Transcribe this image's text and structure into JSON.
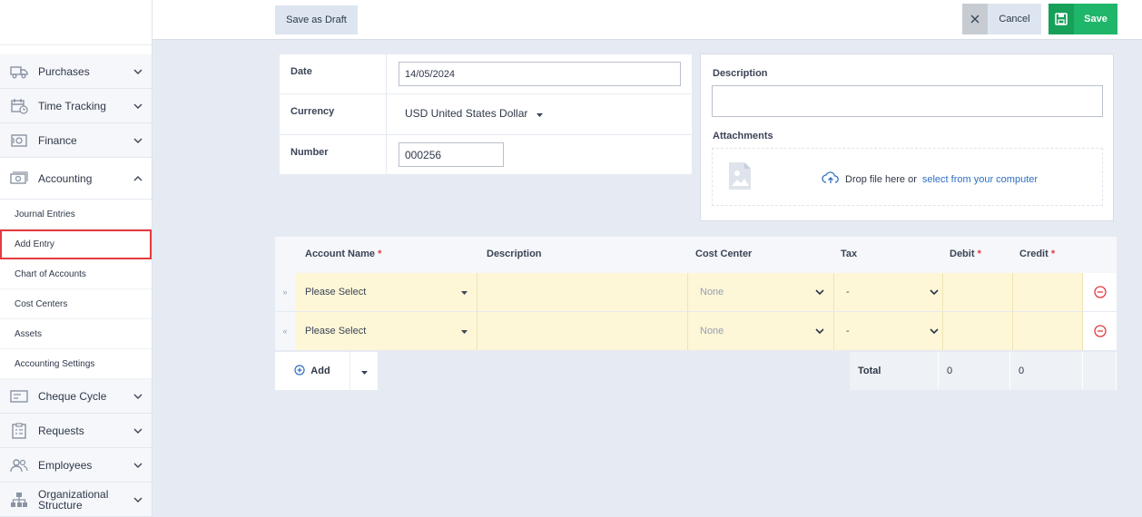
{
  "sidebar": {
    "sections": [
      {
        "label": "Purchases",
        "icon": "truck-icon",
        "expanded": false
      },
      {
        "label": "Time Tracking",
        "icon": "calendar-clock-icon",
        "expanded": false
      },
      {
        "label": "Finance",
        "icon": "safe-icon",
        "expanded": false
      },
      {
        "label": "Accounting",
        "icon": "money-icon",
        "expanded": true
      },
      {
        "label": "Cheque Cycle",
        "icon": "cheque-icon",
        "expanded": false
      },
      {
        "label": "Requests",
        "icon": "clipboard-icon",
        "expanded": false
      },
      {
        "label": "Employees",
        "icon": "users-icon",
        "expanded": false
      },
      {
        "label": "Organizational Structure",
        "icon": "org-chart-icon",
        "expanded": false
      }
    ],
    "accounting_items": [
      {
        "label": "Journal Entries"
      },
      {
        "label": "Add Entry",
        "active": true
      },
      {
        "label": "Chart of Accounts"
      },
      {
        "label": "Cost Centers"
      },
      {
        "label": "Assets"
      },
      {
        "label": "Accounting Settings"
      }
    ]
  },
  "toolbar": {
    "draft_label": "Save as Draft",
    "cancel_label": "Cancel",
    "save_label": "Save"
  },
  "form": {
    "date_label": "Date",
    "date_value": "14/05/2024",
    "currency_label": "Currency",
    "currency_value": "USD United States Dollar",
    "number_label": "Number",
    "number_value": "000256"
  },
  "details": {
    "description_label": "Description",
    "description_value": "",
    "attachments_label": "Attachments",
    "drop_text": "Drop file here or",
    "drop_link": "select from your computer"
  },
  "table": {
    "headers": {
      "account": "Account Name",
      "description": "Description",
      "cost_center": "Cost Center",
      "tax": "Tax",
      "debit": "Debit",
      "credit": "Credit",
      "required_mark": "*"
    },
    "rows": [
      {
        "account": "Please Select",
        "description": "",
        "cost_center": "None",
        "tax": "-",
        "debit": "",
        "credit": ""
      },
      {
        "account": "Please Select",
        "description": "",
        "cost_center": "None",
        "tax": "-",
        "debit": "",
        "credit": ""
      }
    ],
    "add_label": "Add",
    "total_label": "Total",
    "total_debit": "0",
    "total_credit": "0"
  },
  "colors": {
    "accent_red": "#e53a40",
    "save_green": "#1fb66a",
    "row_highlight": "#fdf6d7",
    "link_blue": "#2e6fc2"
  }
}
